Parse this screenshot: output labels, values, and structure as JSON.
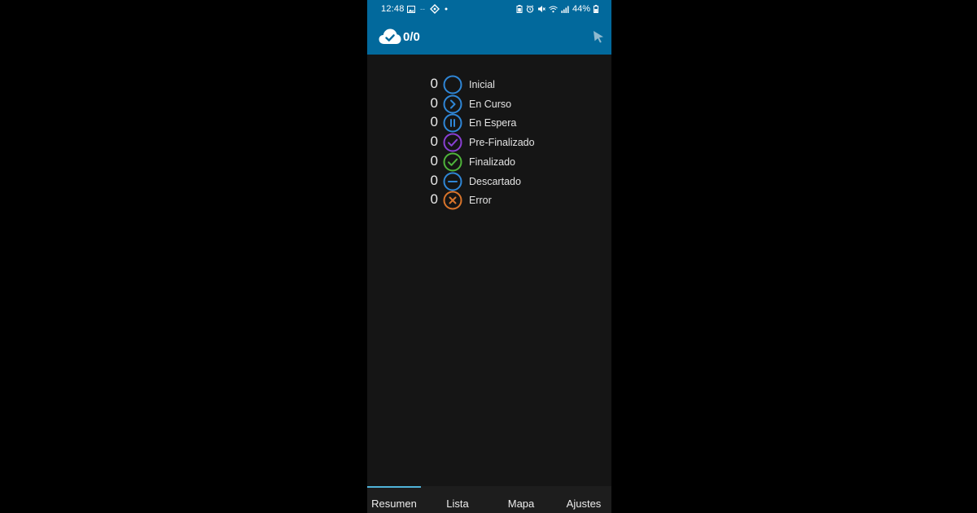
{
  "status_bar": {
    "time": "12:48",
    "battery": "44%"
  },
  "app_bar": {
    "sync_counter": "0/0"
  },
  "summary": {
    "rows": [
      {
        "count": "0",
        "label": "Inicial",
        "color": "#2f86d6",
        "icon": "circle-empty-icon"
      },
      {
        "count": "0",
        "label": "En Curso",
        "color": "#2f86d6",
        "icon": "chevron-right-icon"
      },
      {
        "count": "0",
        "label": "En Espera",
        "color": "#2f86d6",
        "icon": "pause-icon"
      },
      {
        "count": "0",
        "label": "Pre-Finalizado",
        "color": "#8a3fd4",
        "icon": "check-icon"
      },
      {
        "count": "0",
        "label": "Finalizado",
        "color": "#4fb43a",
        "icon": "check-icon"
      },
      {
        "count": "0",
        "label": "Descartado",
        "color": "#2f86d6",
        "icon": "minus-icon"
      },
      {
        "count": "0",
        "label": "Error",
        "color": "#d8742b",
        "icon": "x-icon"
      }
    ]
  },
  "tabs": [
    {
      "label": "Resumen",
      "active": true
    },
    {
      "label": "Lista",
      "active": false
    },
    {
      "label": "Mapa",
      "active": false
    },
    {
      "label": "Ajustes",
      "active": false
    }
  ],
  "colors": {
    "header": "#02699c",
    "background": "#151515",
    "tab_indicator": "#4fb3d9"
  }
}
